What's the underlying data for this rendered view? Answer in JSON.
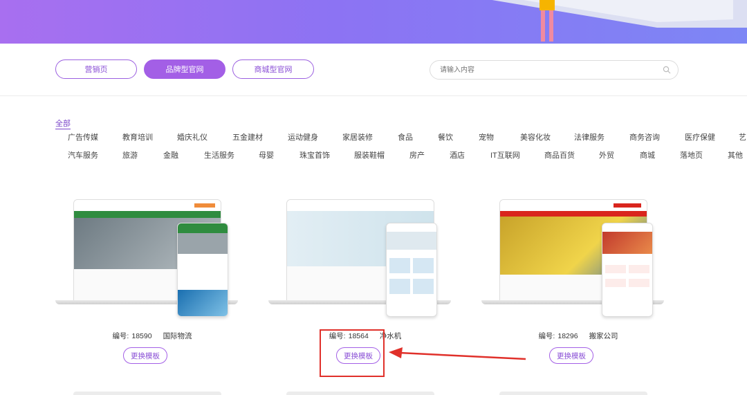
{
  "type_tabs": [
    {
      "label": "营销页",
      "active": false
    },
    {
      "label": "品牌型官网",
      "active": true
    },
    {
      "label": "商城型官网",
      "active": false
    }
  ],
  "search": {
    "placeholder": "请输入内容"
  },
  "categories": {
    "all_label": "全部",
    "row1": [
      "广告传媒",
      "教育培训",
      "婚庆礼仪",
      "五金建材",
      "运动健身",
      "家居装修",
      "食品",
      "餐饮",
      "宠物",
      "美容化妆",
      "法律服务",
      "商务咨询",
      "医疗保健",
      "艺"
    ],
    "row2": [
      "汽车服务",
      "旅游",
      "金融",
      "生活服务",
      "母婴",
      "珠宝首饰",
      "服装鞋帽",
      "房产",
      "酒店",
      "IT互联网",
      "商品百货",
      "外贸",
      "商城",
      "落地页",
      "其他"
    ]
  },
  "templates": [
    {
      "id_label": "编号:",
      "id": "18590",
      "name": "国际物流",
      "button": "更换模板"
    },
    {
      "id_label": "编号:",
      "id": "18564",
      "name": "净水机",
      "button": "更换模板"
    },
    {
      "id_label": "编号:",
      "id": "18296",
      "name": "搬家公司",
      "button": "更换模板"
    }
  ],
  "colors": {
    "accent": "#a35fe6",
    "annotation": "#e0302a"
  }
}
